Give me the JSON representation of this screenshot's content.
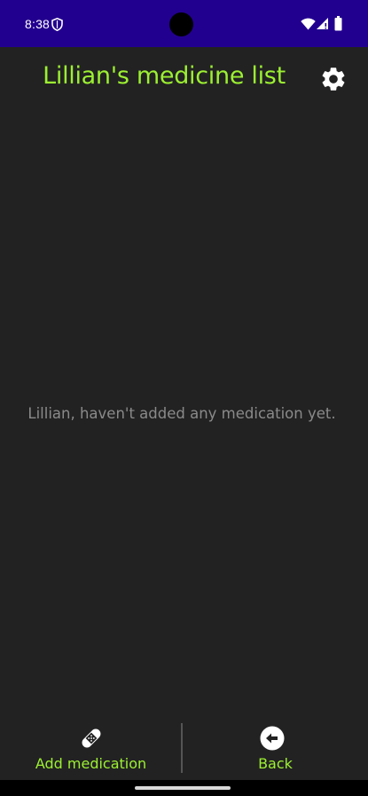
{
  "status_bar": {
    "time": "8:38",
    "background_color": "#22008f",
    "icons": [
      "shield-icon",
      "wifi-icon",
      "signal-icon",
      "battery-icon"
    ]
  },
  "header": {
    "title": "Lillian's medicine list",
    "title_color": "#9cf032",
    "settings_icon": "gear-icon"
  },
  "main": {
    "empty_message": "Lillian, haven't added any medication yet."
  },
  "bottom_bar": {
    "add": {
      "label": "Add medication",
      "icon": "bandage-icon"
    },
    "back": {
      "label": "Back",
      "icon": "arrow-left-circle-icon"
    }
  }
}
